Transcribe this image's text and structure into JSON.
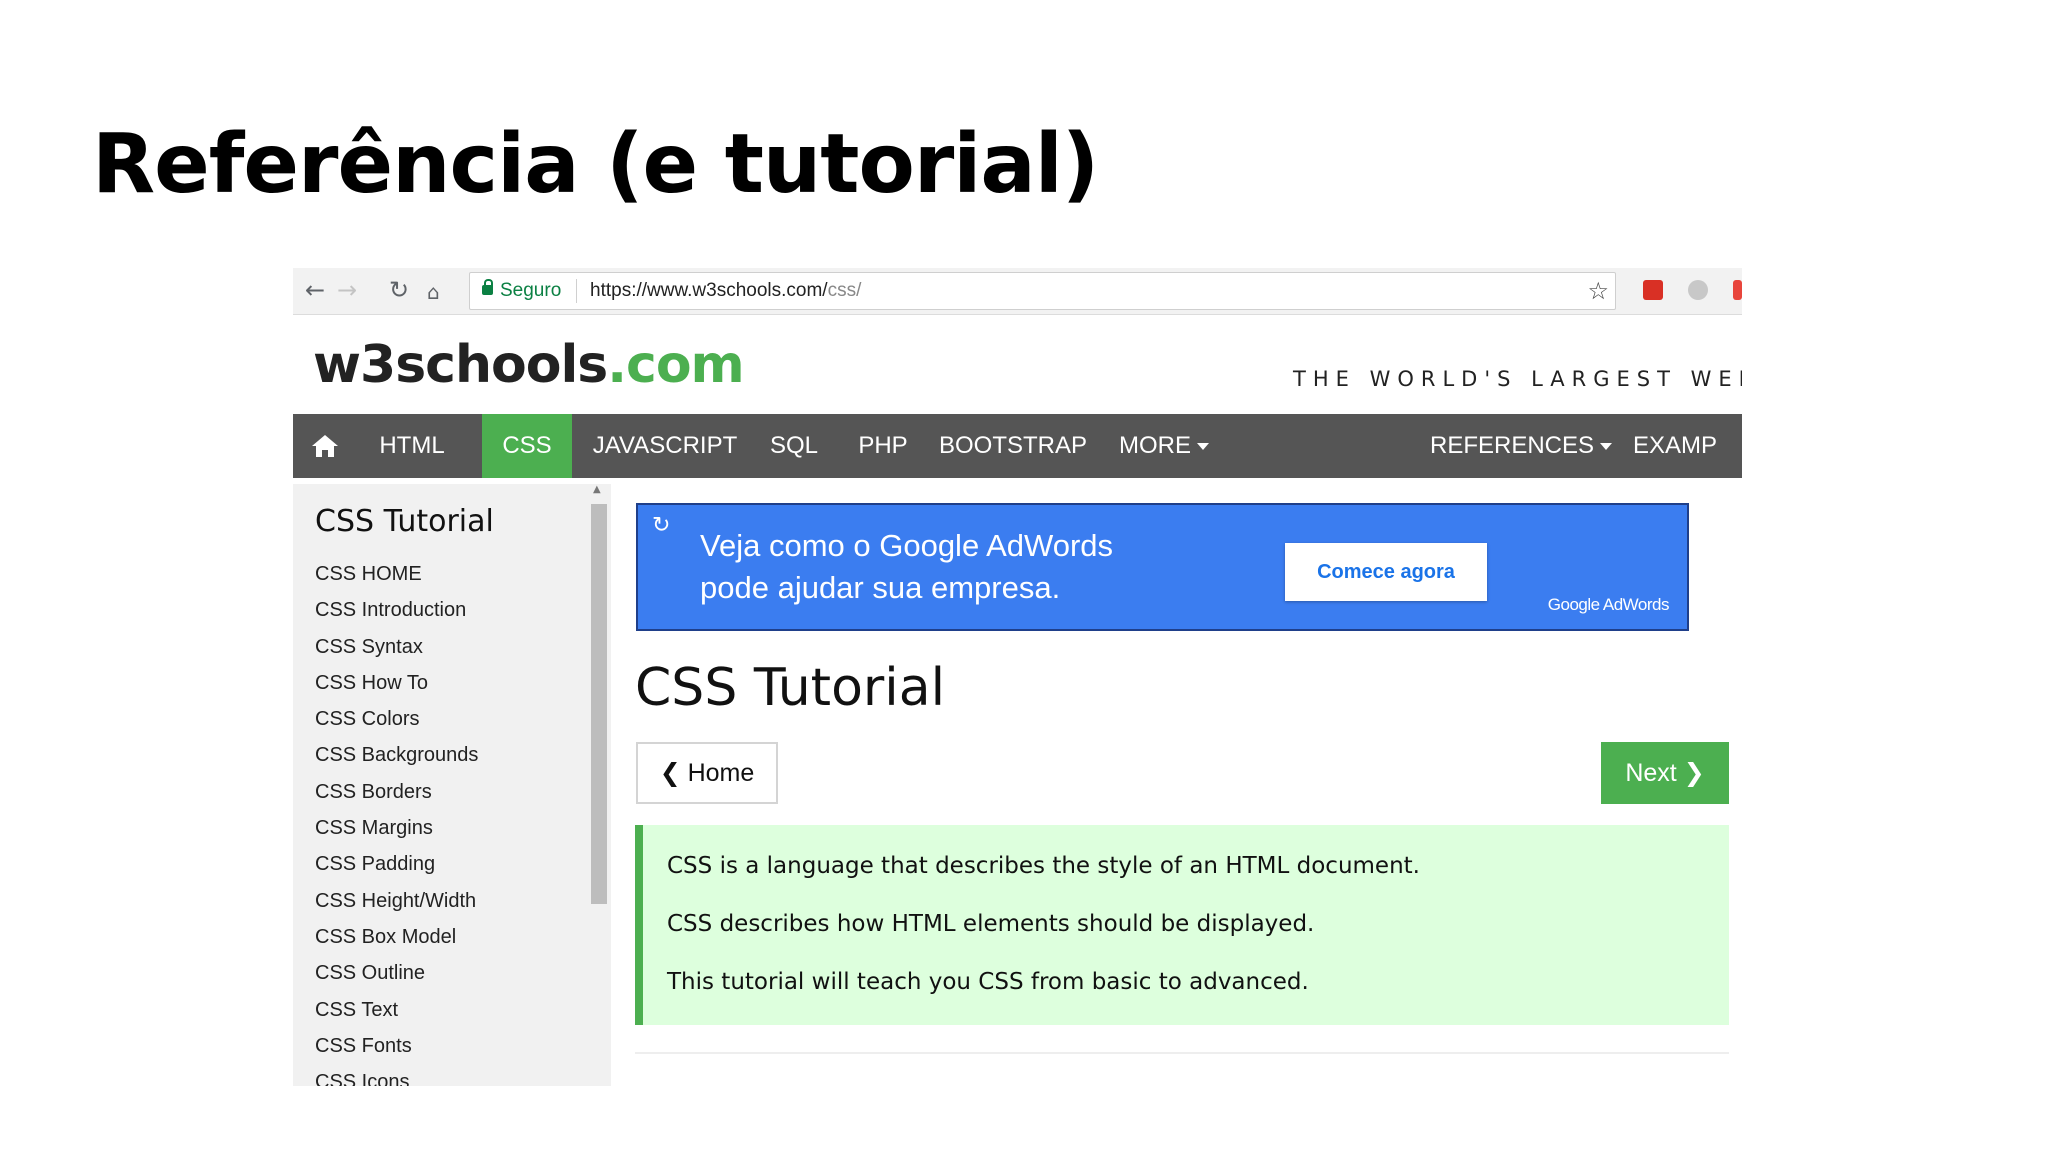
{
  "slide": {
    "title": "Referência (e tutorial)"
  },
  "browser": {
    "secure_label": "Seguro",
    "url_base": "https://www.w3schools.com/",
    "url_path": "css/"
  },
  "site": {
    "logo_main": "w3schools",
    "logo_tld": ".com",
    "tagline": "THE WORLD'S LARGEST WEB DE"
  },
  "topnav": {
    "items": [
      "HTML",
      "CSS",
      "JAVASCRIPT",
      "SQL",
      "PHP",
      "BOOTSTRAP",
      "MORE",
      "REFERENCES",
      "EXAMP"
    ],
    "active": "CSS",
    "accent_color": "#4CAF50",
    "bar_color": "#555555"
  },
  "sidebar": {
    "title": "CSS Tutorial",
    "items": [
      "CSS HOME",
      "CSS Introduction",
      "CSS Syntax",
      "CSS How To",
      "CSS Colors",
      "CSS Backgrounds",
      "CSS Borders",
      "CSS Margins",
      "CSS Padding",
      "CSS Height/Width",
      "CSS Box Model",
      "CSS Outline",
      "CSS Text",
      "CSS Fonts",
      "CSS Icons"
    ]
  },
  "ad": {
    "line1": "Veja como o Google AdWords",
    "line2": "pode ajudar sua empresa.",
    "cta": "Comece agora",
    "brand": "Google AdWords",
    "color": "#3b7df0"
  },
  "main": {
    "heading": "CSS Tutorial",
    "prev_label": "❮ Home",
    "next_label": "Next ❯",
    "intro": [
      "CSS is a language that describes the style of an HTML document.",
      "CSS describes how HTML elements should be displayed.",
      "This tutorial will teach you CSS from basic to advanced."
    ]
  }
}
